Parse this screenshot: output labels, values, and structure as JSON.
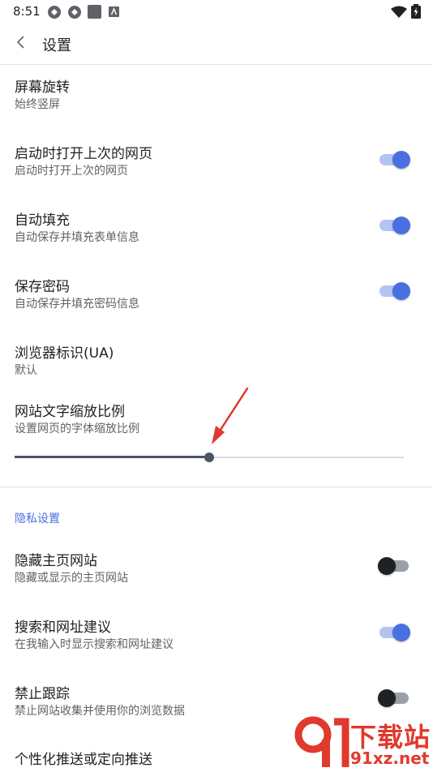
{
  "status_bar": {
    "time": "8:51",
    "icons": [
      "notification-icon",
      "notification-icon",
      "square-icon",
      "app-icon",
      "wifi-icon",
      "battery-icon"
    ]
  },
  "header": {
    "title": "设置"
  },
  "settings": [
    {
      "id": "rotate",
      "title": "屏幕旋转",
      "subtitle": "始终竖屏"
    },
    {
      "id": "restore",
      "title": "启动时打开上次的网页",
      "subtitle": "启动时打开上次的网页",
      "switch": "on"
    },
    {
      "id": "autofill",
      "title": "自动填充",
      "subtitle": "自动保存并填充表单信息",
      "switch": "on"
    },
    {
      "id": "password",
      "title": "保存密码",
      "subtitle": "自动保存并填充密码信息",
      "switch": "on"
    },
    {
      "id": "ua",
      "title": "浏览器标识(UA)",
      "subtitle": "默认"
    },
    {
      "id": "textscale",
      "title": "网站文字缩放比例",
      "subtitle": "设置网页的字体缩放比例"
    }
  ],
  "text_scale_slider": {
    "value_fraction": 0.5
  },
  "privacy": {
    "section_title": "隐私设置",
    "items": [
      {
        "id": "hide-home",
        "title": "隐藏主页网站",
        "subtitle": "隐藏或显示的主页网站",
        "switch": "off"
      },
      {
        "id": "suggest",
        "title": "搜索和网址建议",
        "subtitle": "在我输入时显示搜索和网址建议",
        "switch": "on"
      },
      {
        "id": "dnt",
        "title": "禁止跟踪",
        "subtitle": "禁止网站收集并使用你的浏览数据",
        "switch": "off"
      },
      {
        "id": "personalized",
        "title": "个性化推送或定向推送",
        "subtitle": ""
      }
    ]
  },
  "watermark": {
    "line1": "下载站",
    "line2": "91xz.net"
  },
  "colors": {
    "accent": "#4a6fe0",
    "arrow": "#e0392d"
  }
}
